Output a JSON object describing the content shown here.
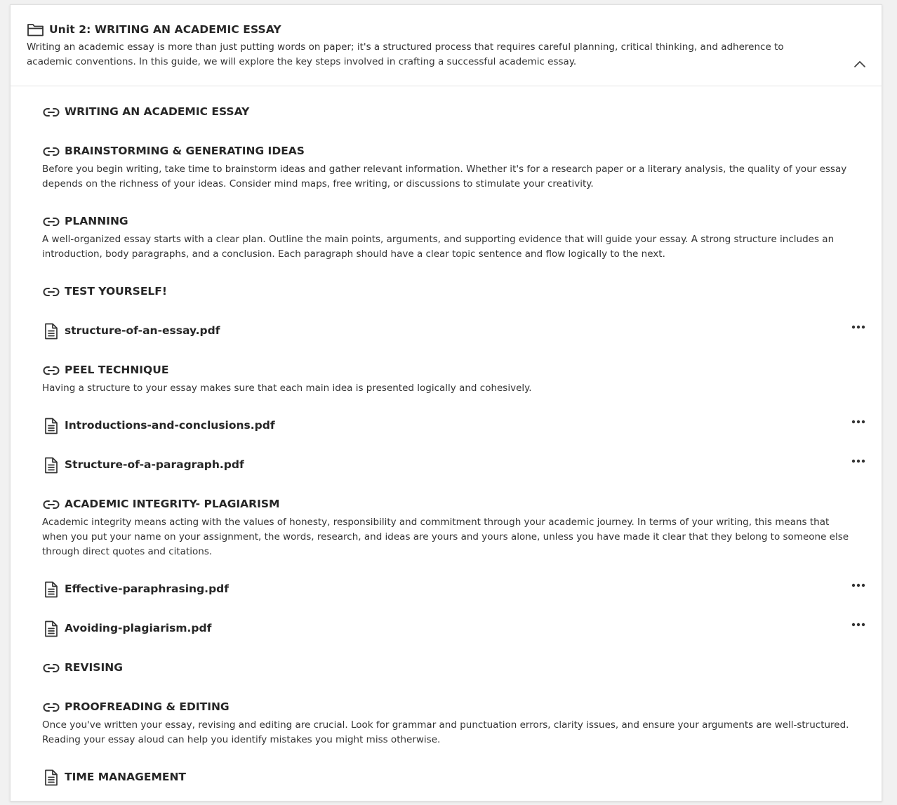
{
  "unit": {
    "title": "Unit 2: WRITING AN ACADEMIC ESSAY",
    "description": "Writing an academic essay is more than just putting words on paper; it's a structured process that requires careful planning, critical thinking, and adherence to academic conventions. In this guide, we will explore the key steps involved in crafting a successful academic essay.",
    "icon": "folder-icon",
    "collapse_icon": "chevron-up-icon"
  },
  "items": [
    {
      "type": "link",
      "icon": "link-icon",
      "title": "WRITING AN ACADEMIC ESSAY",
      "description": ""
    },
    {
      "type": "link",
      "icon": "link-icon",
      "title": "BRAINSTORMING & GENERATING IDEAS",
      "description": "Before you begin writing, take time to brainstorm ideas and gather relevant information. Whether it's for a research paper or a literary analysis, the quality of your essay depends on the richness of your ideas. Consider mind maps, free writing, or discussions to stimulate your creativity."
    },
    {
      "type": "link",
      "icon": "link-icon",
      "title": "PLANNING",
      "description": "A well-organized essay starts with a clear plan. Outline the main points, arguments, and supporting evidence that will guide your essay. A strong structure includes an introduction, body paragraphs, and a conclusion. Each paragraph should have a clear topic sentence and flow logically to the next."
    },
    {
      "type": "link",
      "icon": "link-icon",
      "title": "TEST YOURSELF!",
      "description": ""
    },
    {
      "type": "file",
      "icon": "document-icon",
      "title": "structure-of-an-essay.pdf",
      "description": ""
    },
    {
      "type": "link",
      "icon": "link-icon",
      "title": "PEEL TECHNIQUE",
      "description": "Having a structure to your essay makes sure that each main idea is presented logically and cohesively."
    },
    {
      "type": "file",
      "icon": "document-icon",
      "title": "Introductions-and-conclusions.pdf",
      "description": ""
    },
    {
      "type": "file",
      "icon": "document-icon",
      "title": "Structure-of-a-paragraph.pdf",
      "description": ""
    },
    {
      "type": "link",
      "icon": "link-icon",
      "title": "ACADEMIC INTEGRITY- PLAGIARISM",
      "description": "Academic integrity means acting with the values of honesty, responsibility and commitment through your academic journey. In terms of your writing, this means that when you put your name on your assignment, the words, research, and ideas are yours and yours alone, unless you have made it clear that they belong to someone else through direct quotes and citations."
    },
    {
      "type": "file",
      "icon": "document-icon",
      "title": "Effective-paraphrasing.pdf",
      "description": ""
    },
    {
      "type": "file",
      "icon": "document-icon",
      "title": "Avoiding-plagiarism.pdf",
      "description": ""
    },
    {
      "type": "link",
      "icon": "link-icon",
      "title": "REVISING",
      "description": ""
    },
    {
      "type": "link",
      "icon": "link-icon",
      "title": "PROOFREADING & EDITING",
      "description": "Once you've written your essay, revising and editing are crucial. Look for grammar and punctuation errors, clarity issues, and ensure your arguments are well-structured. Reading your essay aloud can help you identify mistakes you might miss otherwise."
    },
    {
      "type": "page",
      "icon": "document-icon",
      "title": "TIME MANAGEMENT",
      "description": ""
    }
  ],
  "more_options_icon": "more-options-icon"
}
